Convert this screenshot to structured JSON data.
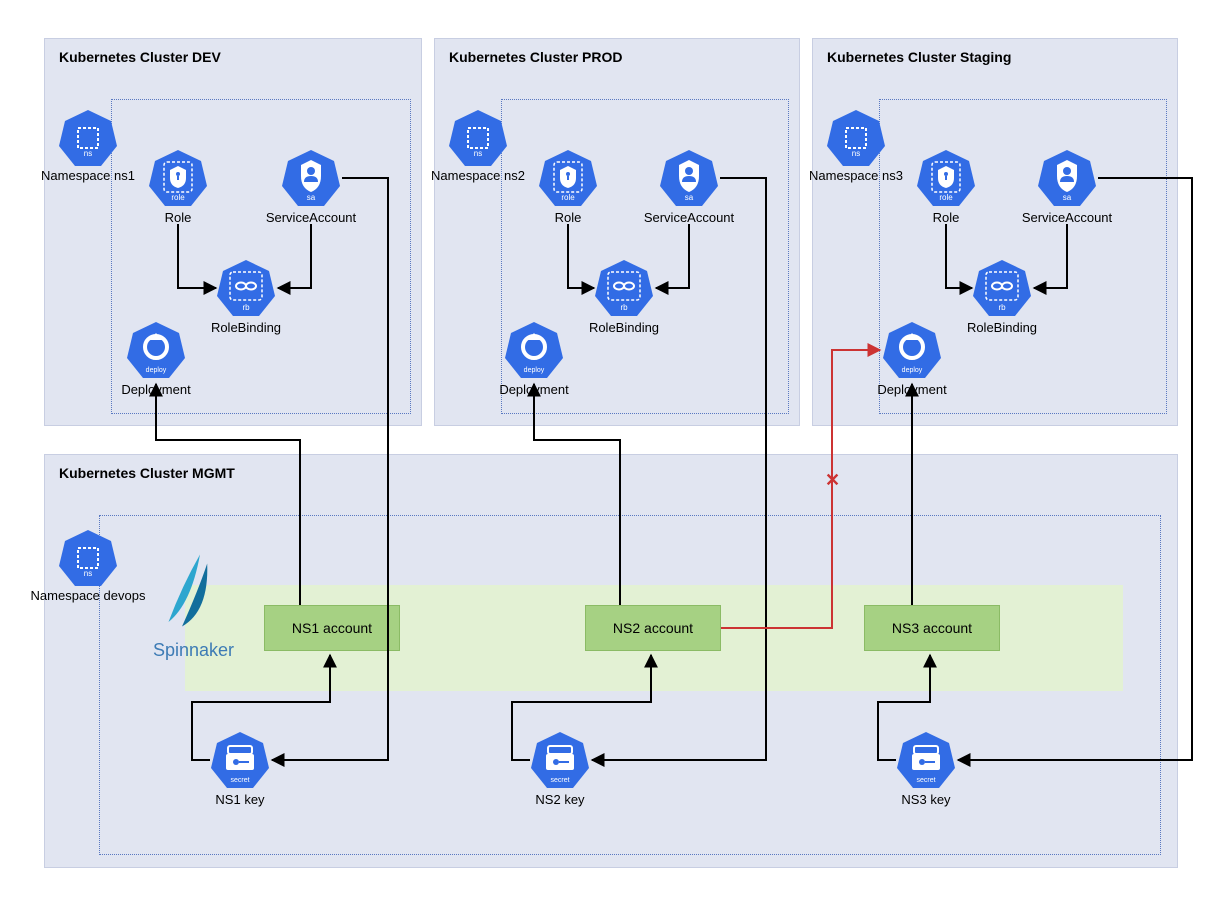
{
  "clusters": {
    "dev": {
      "title": "Kubernetes Cluster DEV",
      "namespace": "Namespace ns1"
    },
    "prod": {
      "title": "Kubernetes Cluster PROD",
      "namespace": "Namespace ns2"
    },
    "staging": {
      "title": "Kubernetes Cluster Staging",
      "namespace": "Namespace ns3"
    },
    "mgmt": {
      "title": "Kubernetes Cluster MGMT",
      "namespace": "Namespace devops"
    }
  },
  "resources": {
    "role": "Role",
    "sa": "ServiceAccount",
    "rb": "RoleBinding",
    "deploy": "Deployment"
  },
  "accounts": {
    "ns1": "NS1 account",
    "ns2": "NS2 account",
    "ns3": "NS3 account"
  },
  "keys": {
    "ns1": "NS1 key",
    "ns2": "NS2 key",
    "ns3": "NS3 key"
  },
  "spinnaker": "Spinnaker",
  "colors": {
    "k8s_blue": "#326ce5",
    "cluster_bg": "#e1e5f1",
    "account_bg": "#a6d183",
    "green_bg": "#e3f1d4",
    "denied": "#c33232"
  },
  "diagram_meaning": "Spinnaker in MGMT cluster uses per-namespace service-account keys (stored as Secrets) to deploy into ns1/ns2/ns3 in DEV/PROD/Staging clusters. NS2 account attempting to reach Staging Deployment is denied (X)."
}
